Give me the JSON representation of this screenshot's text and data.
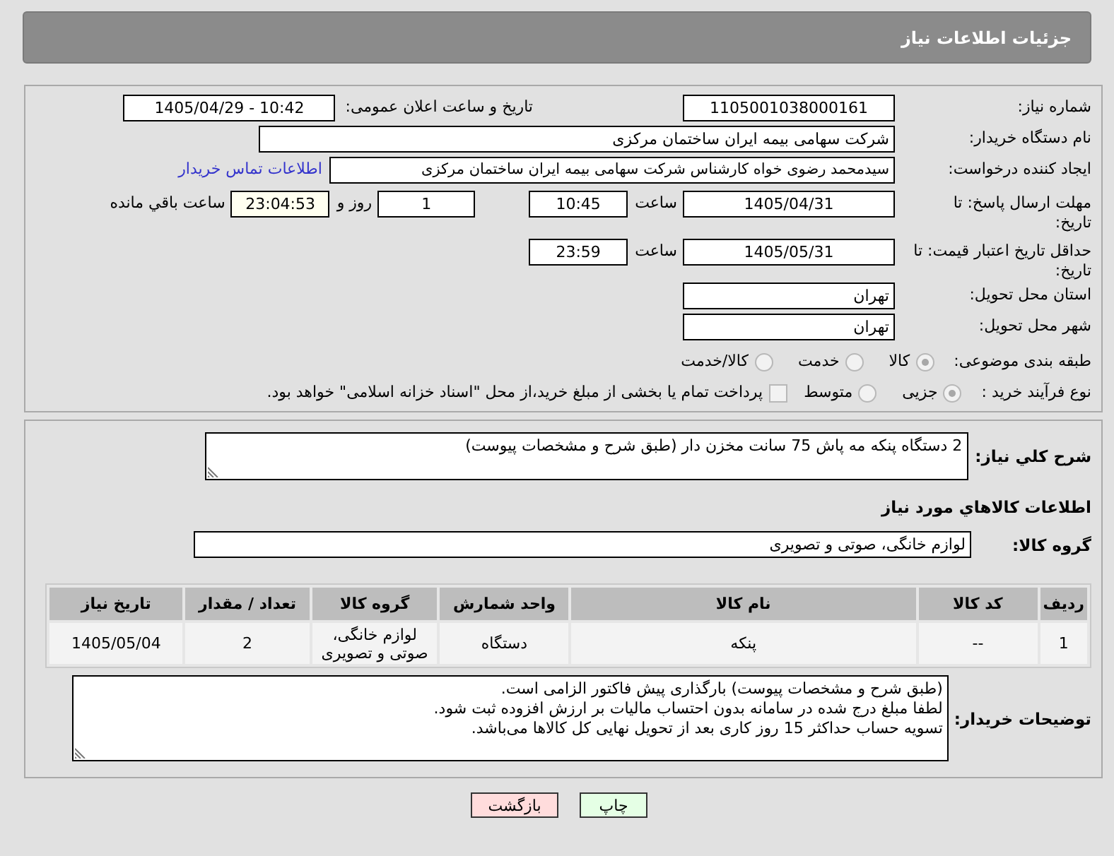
{
  "header": {
    "title": "جزئیات اطلاعات نیاز"
  },
  "details": {
    "need_number": {
      "label": "شماره نیاز:",
      "value": "1105001038000161"
    },
    "announcement": {
      "label": "تاریخ و ساعت اعلان عمومی:",
      "value": "1405/04/29 - 10:42"
    },
    "buyer_organization": {
      "label": "نام دستگاه خریدار:",
      "value": "شرکت سهامی بیمه ایران ساختمان مرکزی"
    },
    "requester": {
      "label": "ایجاد کننده درخواست:",
      "value": "سیدمحمد رضوی خواه کارشناس شرکت سهامی بیمه ایران ساختمان مرکزی",
      "contact_link": "اطلاعات تماس خریدار"
    },
    "response_deadline": {
      "label": "مهلت ارسال پاسخ: تا تاریخ:",
      "date": "1405/04/31",
      "time_label": "ساعت",
      "time": "10:45",
      "days": "1",
      "days_label": "روز و",
      "remaining": "23:04:53",
      "remaining_label": "ساعت باقي مانده"
    },
    "price_validity": {
      "label": "حداقل تاریخ اعتبار قیمت: تا تاریخ:",
      "date": "1405/05/31",
      "time_label": "ساعت",
      "time": "23:59"
    },
    "delivery_province": {
      "label": "استان محل تحویل:",
      "value": "تهران"
    },
    "delivery_city": {
      "label": "شهر محل تحویل:",
      "value": "تهران"
    },
    "subject_category": {
      "label": "طبقه بندی موضوعی:",
      "options": [
        {
          "label": "کالا",
          "selected": true,
          "disabled": true
        },
        {
          "label": "خدمت",
          "selected": false,
          "disabled": true
        },
        {
          "label": "کالا/خدمت",
          "selected": false,
          "disabled": true
        }
      ]
    },
    "purchase_process": {
      "label": "نوع فرآیند خرید :",
      "options": [
        {
          "label": "جزیی",
          "selected": true,
          "disabled": true
        },
        {
          "label": "متوسط",
          "selected": false,
          "disabled": true
        }
      ],
      "treasury_payment": {
        "label": "پرداخت تمام یا بخشی از مبلغ خرید،از محل \"اسناد خزانه اسلامی\" خواهد بود.",
        "checked": false,
        "disabled": true
      }
    }
  },
  "need_description": {
    "label": "شرح کلي نیاز:",
    "value": "2 دستگاه پنکه مه پاش 75 سانت مخزن دار (طبق شرح و مشخصات پیوست)"
  },
  "goods": {
    "heading": "اطلاعات کالاهاي مورد نیاز",
    "group_label": "گروه کالا:",
    "group_value": "لوازم خانگی، صوتی و تصویری",
    "table": {
      "columns": [
        "ردیف",
        "کد کالا",
        "نام کالا",
        "واحد شمارش",
        "گروه کالا",
        "تعداد / مقدار",
        "تاریخ نیاز"
      ],
      "rows": [
        [
          "1",
          "--",
          "پنکه",
          "دستگاه",
          "لوازم خانگی، صوتی و تصویری",
          "2",
          "1405/05/04"
        ]
      ]
    }
  },
  "buyer_notes": {
    "label": "توضیحات خریدار:",
    "value": "(طبق شرح و مشخصات پیوست) بارگذاری پیش فاکتور الزامی است.\nلطفا مبلغ درج شده در سامانه بدون احتساب مالیات بر ارزش افزوده ثبت شود.\nتسویه حساب حداکثر 15 روز کاری بعد از تحویل نهایی کل کالاها می‌باشد."
  },
  "buttons": [
    {
      "kind": "print",
      "label": "چاپ"
    },
    {
      "kind": "back",
      "label": "بازگشت"
    }
  ]
}
